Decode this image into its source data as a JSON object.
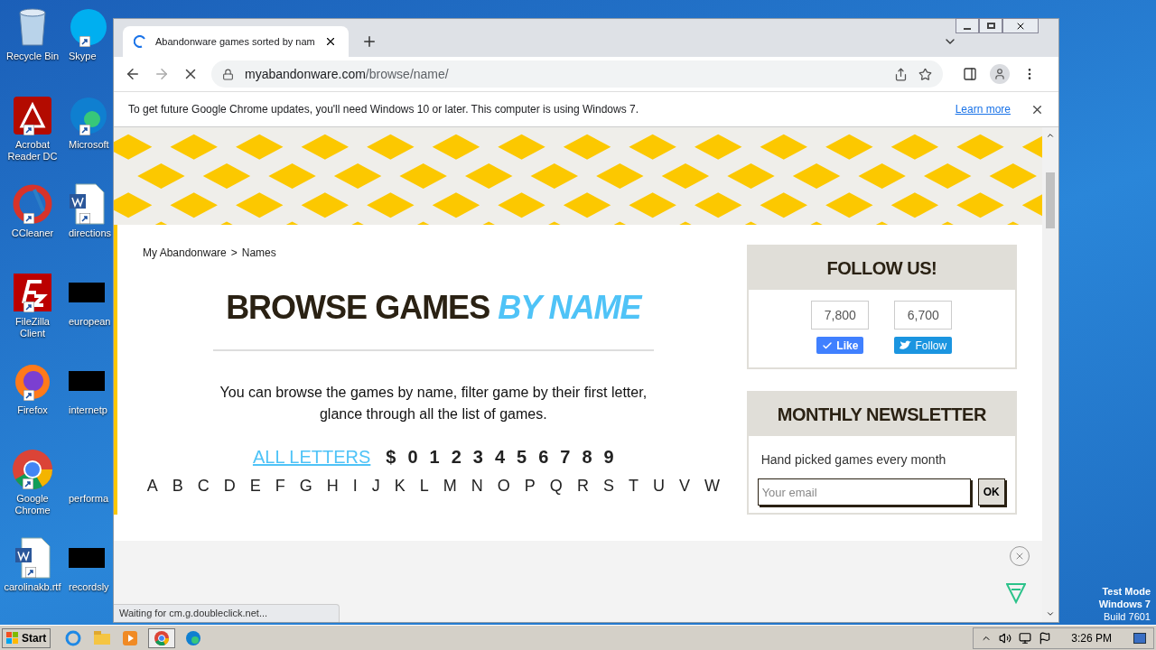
{
  "desktop_icons_left": [
    {
      "label": "Recycle Bin",
      "kind": "recycle"
    },
    {
      "label": "Acrobat Reader DC",
      "kind": "acrobat"
    },
    {
      "label": "CCleaner",
      "kind": "ccleaner"
    },
    {
      "label": "FileZilla Client",
      "kind": "filezilla"
    },
    {
      "label": "Firefox",
      "kind": "firefox"
    },
    {
      "label": "Google Chrome",
      "kind": "chrome"
    },
    {
      "label": "carolinakb.rtf",
      "kind": "word"
    }
  ],
  "desktop_icons_right": [
    {
      "label": "Skype",
      "kind": "skype"
    },
    {
      "label": "Microsoft",
      "kind": "edge"
    },
    {
      "label": "directions",
      "kind": "word"
    },
    {
      "label": "european",
      "kind": "redacted"
    },
    {
      "label": "internetp",
      "kind": "redacted"
    },
    {
      "label": "performa",
      "kind": "blank"
    },
    {
      "label": "recordsly",
      "kind": "redacted"
    }
  ],
  "browser": {
    "tab": {
      "title": "Abandonware games sorted by nam",
      "loading": true
    },
    "address": {
      "domain": "myabandonware.com",
      "path": "/browse/name/"
    },
    "infobar": {
      "message": "To get future Google Chrome updates, you'll need Windows 10 or later. This computer is using Windows 7.",
      "link": "Learn more"
    },
    "status": "Waiting for cm.g.doubleclick.net..."
  },
  "page": {
    "breadcrumb": {
      "home": "My Abandonware",
      "separator": ">",
      "current": "Names"
    },
    "heading": {
      "main": "BROWSE GAMES",
      "accent": "BY NAME"
    },
    "intro": "You can browse the games by name, filter game by their first letter, glance through all the list of games.",
    "filters": [
      {
        "label": "ALL LETTERS",
        "selected": true
      },
      {
        "label": "$",
        "selected": false
      },
      {
        "label": "0",
        "selected": false
      },
      {
        "label": "1",
        "selected": false
      },
      {
        "label": "2",
        "selected": false
      },
      {
        "label": "3",
        "selected": false
      },
      {
        "label": "4",
        "selected": false
      },
      {
        "label": "5",
        "selected": false
      },
      {
        "label": "6",
        "selected": false
      },
      {
        "label": "7",
        "selected": false
      },
      {
        "label": "8",
        "selected": false
      },
      {
        "label": "9",
        "selected": false
      }
    ],
    "letters": [
      "A",
      "B",
      "C",
      "D",
      "E",
      "F",
      "G",
      "H",
      "I",
      "J",
      "K",
      "L",
      "M",
      "N",
      "O",
      "P",
      "Q",
      "R",
      "S",
      "T",
      "U",
      "V",
      "W"
    ],
    "follow": {
      "title": "FOLLOW US!",
      "like_count": "7,800",
      "like_label": "Like",
      "follow_count": "6,700",
      "follow_label": "Follow"
    },
    "newsletter": {
      "title": "MONTHLY NEWSLETTER",
      "text": "Hand picked games every month",
      "placeholder": "Your email",
      "button": "OK"
    }
  },
  "desktop_notice": [
    "Test Mode",
    "Windows 7",
    "Build 7601"
  ],
  "taskbar": {
    "start": "Start",
    "time": "3:26 PM"
  }
}
